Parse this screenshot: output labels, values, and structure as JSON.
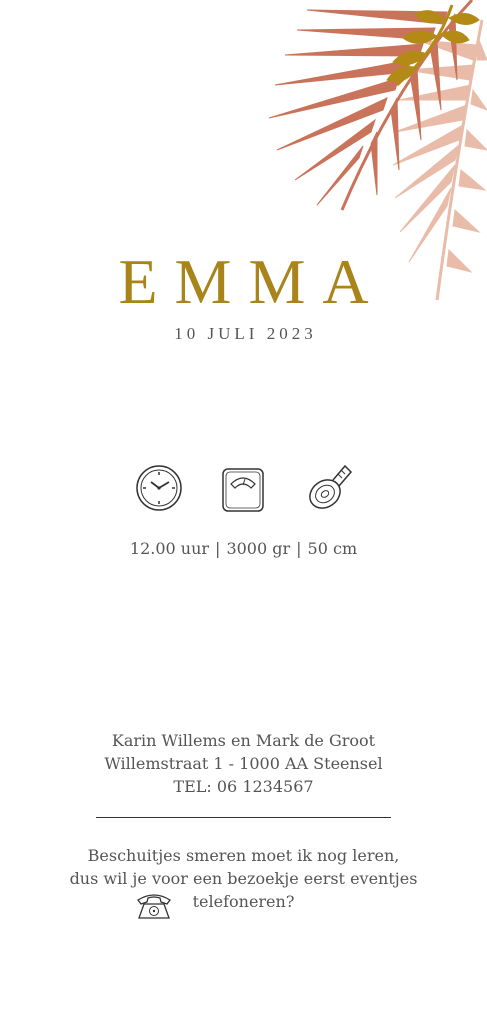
{
  "card": {
    "name": "EMMA",
    "date": "10 JULI 2023",
    "accent_color": "#a8841a",
    "leaf_colors": [
      "#c9735a",
      "#e9bca9",
      "#b38a16"
    ]
  },
  "stats": {
    "icons": [
      "clock-icon",
      "scale-icon",
      "tape-measure-icon"
    ],
    "time": "12.00 uur",
    "weight": "3000 gr",
    "length": "50 cm",
    "separator": "|"
  },
  "parents": {
    "names": "Karin Willems en Mark de Groot",
    "address": "Willemstraat 1 - 1000 AA Steensel",
    "phone": "TEL: 06 1234567"
  },
  "message": {
    "line1": "Beschuitjes smeren moet ik nog leren,",
    "line2": "dus wil je voor een bezoekje eerst eventjes",
    "line3": "telefoneren?",
    "icon": "telephone-icon"
  }
}
